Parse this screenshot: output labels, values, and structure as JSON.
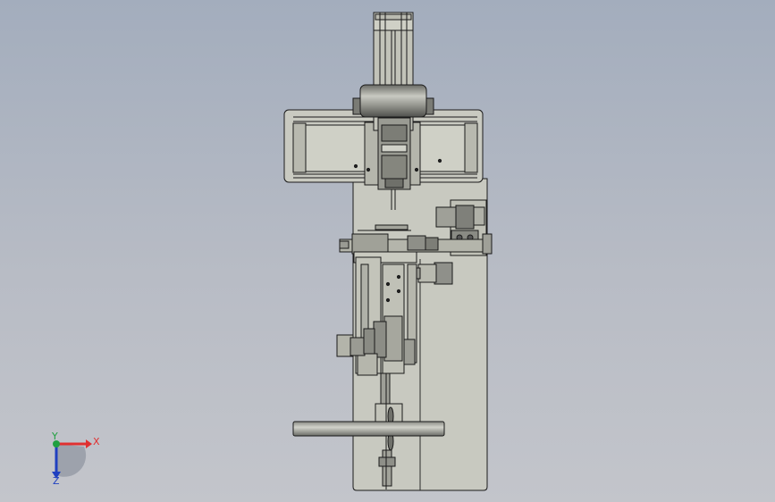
{
  "viewport": {
    "background_top": "#a3adbd",
    "background_bottom": "#c3c5cb",
    "model_fill": "#c5c6bd",
    "model_stroke": "#1a1a1a"
  },
  "triad": {
    "x_label": "X",
    "y_label": "Y",
    "z_label": "Z",
    "x_color": "#e03030",
    "y_color": "#20a040",
    "z_color": "#2040c0"
  }
}
